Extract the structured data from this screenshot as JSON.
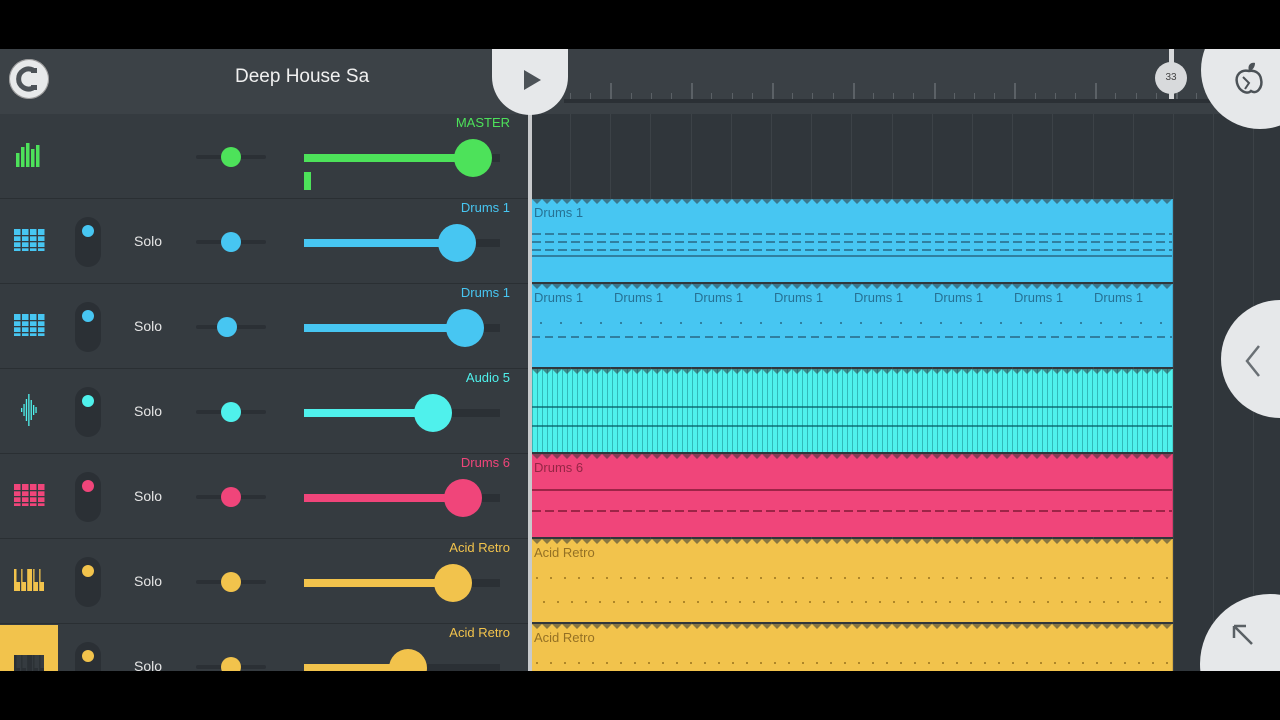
{
  "header": {
    "project_title": "Deep House Sa",
    "bar_marker": "33"
  },
  "icons": {
    "magnet": "magnet-icon",
    "play": "play-icon",
    "fl_menu": "fruit-logo-icon",
    "collapse": "chevron-left-icon",
    "expand": "arrow-up-left-icon"
  },
  "colors": {
    "master": "#4de25a",
    "drums_blue": "#47c6f2",
    "audio_cyan": "#4ff1ec",
    "drums_pink": "#f0457a",
    "acid_yellow": "#f2c34c"
  },
  "tracks": [
    {
      "name": "MASTER",
      "solo": "",
      "color": "#4de25a",
      "icon": "mixer-bars-icon",
      "pan": 0.5,
      "volume": 0.86,
      "has_mute": false
    },
    {
      "name": "Drums 1",
      "solo": "Solo",
      "color": "#47c6f2",
      "icon": "drum-pads-icon",
      "pan": 0.5,
      "volume": 0.78,
      "has_mute": true
    },
    {
      "name": "Drums 1",
      "solo": "Solo",
      "color": "#47c6f2",
      "icon": "drum-pads-icon",
      "pan": 0.44,
      "volume": 0.82,
      "has_mute": true
    },
    {
      "name": "Audio 5",
      "solo": "Solo",
      "color": "#4ff1ec",
      "icon": "waveform-icon",
      "pan": 0.5,
      "volume": 0.66,
      "has_mute": true
    },
    {
      "name": "Drums 6",
      "solo": "Solo",
      "color": "#f0457a",
      "icon": "drum-pads-icon",
      "pan": 0.5,
      "volume": 0.81,
      "has_mute": true
    },
    {
      "name": "Acid Retro",
      "solo": "Solo",
      "color": "#f2c34c",
      "icon": "piano-keys-icon",
      "pan": 0.5,
      "volume": 0.76,
      "has_mute": true
    },
    {
      "name": "Acid Retro",
      "solo": "Solo",
      "color": "#f2c34c",
      "icon": "piano-keys-icon",
      "pan": 0.5,
      "volume": 0.53,
      "has_mute": true
    }
  ],
  "clips": [
    {
      "lane": 1,
      "labels": [
        "Drums 1"
      ]
    },
    {
      "lane": 2,
      "labels": [
        "Drums 1",
        "Drums 1",
        "Drums 1",
        "Drums 1",
        "Drums 1",
        "Drums 1",
        "Drums 1",
        "Drums 1"
      ]
    },
    {
      "lane": 3,
      "labels": [
        ""
      ]
    },
    {
      "lane": 4,
      "labels": [
        "Drums 6"
      ]
    },
    {
      "lane": 5,
      "labels": [
        "Acid Retro"
      ]
    },
    {
      "lane": 6,
      "labels": [
        "Acid Retro"
      ]
    }
  ]
}
